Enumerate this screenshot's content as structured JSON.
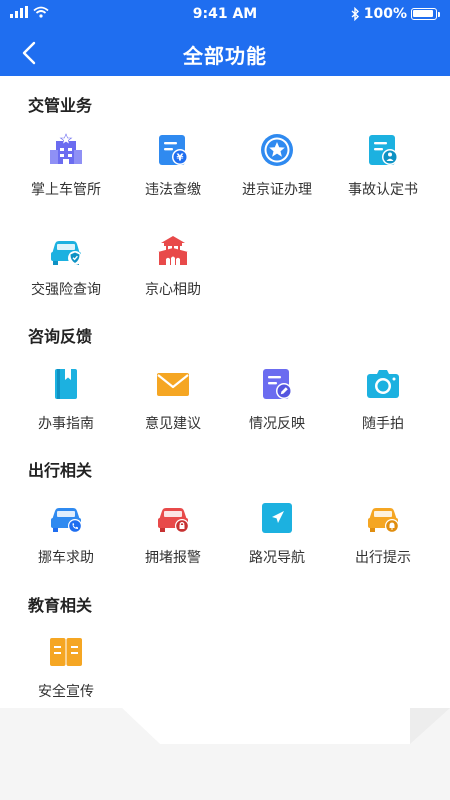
{
  "status_bar": {
    "time": "9:41 AM",
    "battery": "100%"
  },
  "header": {
    "title": "全部功能"
  },
  "sections": [
    {
      "title": "交管业务",
      "items": [
        {
          "label": "掌上车管所",
          "icon": "office-building-icon"
        },
        {
          "label": "违法查缴",
          "icon": "fine-document-icon"
        },
        {
          "label": "进京证办理",
          "icon": "star-badge-icon"
        },
        {
          "label": "事故认定书",
          "icon": "accident-document-icon"
        },
        {
          "label": "交强险查询",
          "icon": "car-insurance-icon"
        },
        {
          "label": "京心相助",
          "icon": "tiananmen-icon"
        }
      ]
    },
    {
      "title": "咨询反馈",
      "items": [
        {
          "label": "办事指南",
          "icon": "guide-book-icon"
        },
        {
          "label": "意见建议",
          "icon": "envelope-icon"
        },
        {
          "label": "情况反映",
          "icon": "edit-document-icon"
        },
        {
          "label": "随手拍",
          "icon": "camera-icon"
        }
      ]
    },
    {
      "title": "出行相关",
      "items": [
        {
          "label": "挪车求助",
          "icon": "car-phone-icon"
        },
        {
          "label": "拥堵报警",
          "icon": "car-alarm-icon"
        },
        {
          "label": "路况导航",
          "icon": "navigation-arrow-icon"
        },
        {
          "label": "出行提示",
          "icon": "car-bell-icon"
        }
      ]
    },
    {
      "title": "教育相关",
      "items": [
        {
          "label": "安全宣传",
          "icon": "open-book-icon"
        }
      ]
    }
  ],
  "colors": {
    "brand_blue": "#1f6ef0",
    "icon_blue": "#2f8af0",
    "icon_orange": "#f5a623",
    "icon_red": "#e84a4a",
    "icon_purple": "#6b6cf0",
    "icon_cyan": "#1cb1e0"
  }
}
